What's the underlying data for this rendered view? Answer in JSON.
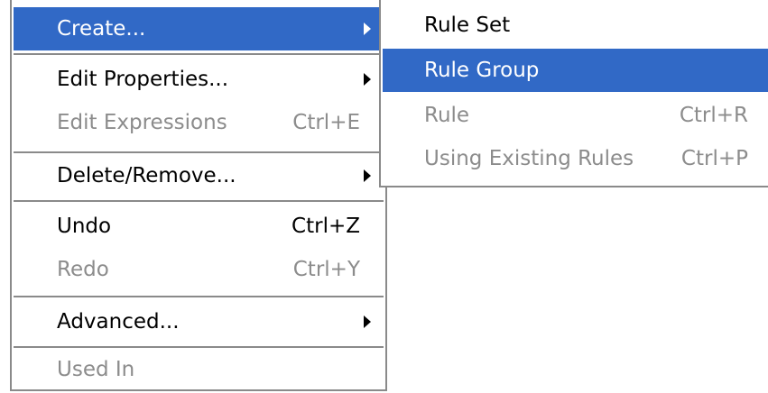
{
  "main_menu": {
    "items": [
      {
        "label": "Create...",
        "shortcut": "",
        "has_submenu": true,
        "disabled": false,
        "highlighted": true
      },
      {
        "label": "Edit Properties...",
        "shortcut": "",
        "has_submenu": true,
        "disabled": false,
        "highlighted": false
      },
      {
        "label": "Edit Expressions",
        "shortcut": "Ctrl+E",
        "has_submenu": false,
        "disabled": true,
        "highlighted": false
      },
      {
        "label": "Delete/Remove...",
        "shortcut": "",
        "has_submenu": true,
        "disabled": false,
        "highlighted": false
      },
      {
        "label": "Undo",
        "shortcut": "Ctrl+Z",
        "has_submenu": false,
        "disabled": false,
        "highlighted": false
      },
      {
        "label": "Redo",
        "shortcut": "Ctrl+Y",
        "has_submenu": false,
        "disabled": true,
        "highlighted": false
      },
      {
        "label": "Advanced...",
        "shortcut": "",
        "has_submenu": true,
        "disabled": false,
        "highlighted": false
      },
      {
        "label": "Used In",
        "shortcut": "",
        "has_submenu": false,
        "disabled": true,
        "highlighted": false
      }
    ]
  },
  "create_submenu": {
    "items": [
      {
        "label": "Rule Set",
        "shortcut": "",
        "disabled": false,
        "highlighted": false
      },
      {
        "label": "Rule Group",
        "shortcut": "",
        "disabled": false,
        "highlighted": true
      },
      {
        "label": "Rule",
        "shortcut": "Ctrl+R",
        "disabled": true,
        "highlighted": false
      },
      {
        "label": "Using Existing Rules",
        "shortcut": "Ctrl+P",
        "disabled": true,
        "highlighted": false
      }
    ]
  },
  "colors": {
    "highlight": "#3169c6",
    "disabled_text": "#8c8c8c",
    "border": "#8a8a8a"
  },
  "icons": {
    "submenu_arrow": "submenu-arrow-icon"
  }
}
